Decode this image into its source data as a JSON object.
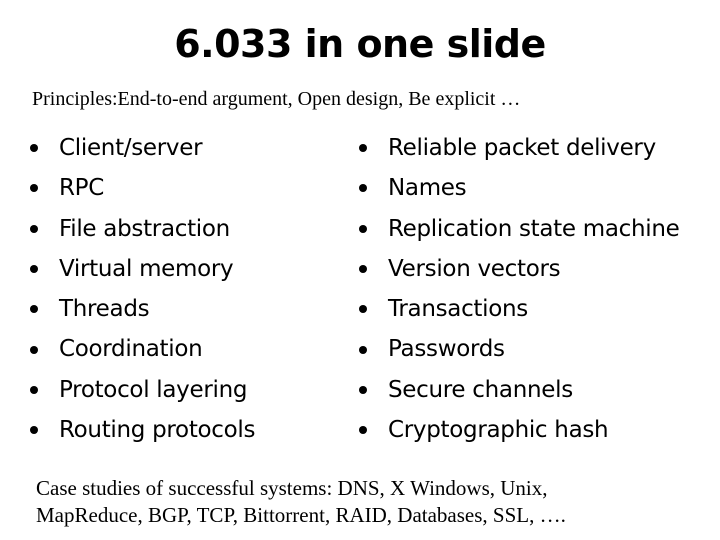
{
  "slide": {
    "title": "6.033 in one slide",
    "principles": "Principles:End-to-end argument, Open design, Be explicit …",
    "left_column": [
      "Client/server",
      "RPC",
      "File abstraction",
      "Virtual memory",
      "Threads",
      "Coordination",
      "Protocol layering",
      "Routing protocols"
    ],
    "right_column": [
      "Reliable packet delivery",
      "Names",
      "Replication state machine",
      "Version vectors",
      "Transactions",
      "Passwords",
      "Secure channels",
      "Cryptographic hash"
    ],
    "case_studies": {
      "line1": "Case studies of successful systems: DNS, X Windows,  Unix,",
      "line2": "MapReduce, BGP, TCP, Bittorrent, RAID, Databases, SSL, …."
    }
  }
}
